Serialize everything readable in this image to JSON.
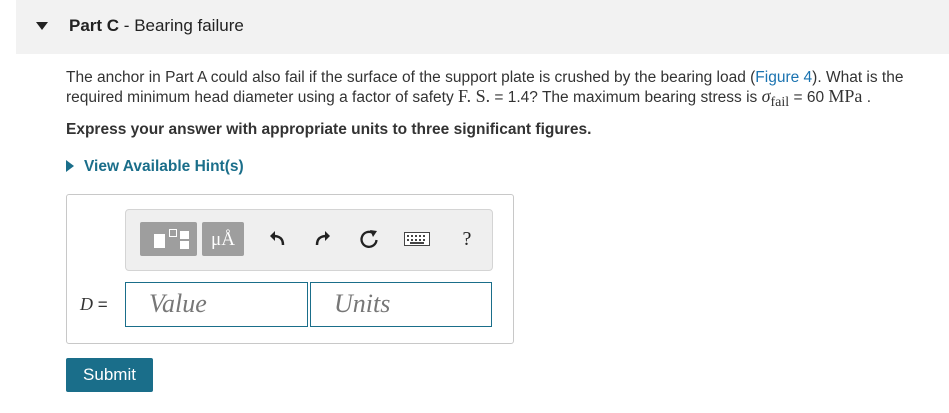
{
  "part": {
    "label": "Part C",
    "separator": " - ",
    "title": "Bearing failure"
  },
  "question": {
    "text1": "The anchor in Part A could also fail if the surface of the support plate is crushed by the bearing load (",
    "figure_link": "Figure 4",
    "text2": "). What is the required minimum head diameter using a factor of safety ",
    "fs_symbol": "F. S.",
    "text3": " = 1.4? The maximum bearing stress is ",
    "sigma": "σ",
    "sigma_sub": "fail",
    "text4": " = 60 ",
    "unit": "MPa",
    "text5": " ."
  },
  "instruction": "Express your answer with appropriate units to three significant figures.",
  "hint_label": "View Available Hint(s)",
  "toolbar": {
    "units_label": "μÅ",
    "help_label": "?"
  },
  "answer": {
    "var_label": "D",
    "equals": " =",
    "value_placeholder": "Value",
    "units_placeholder": "Units"
  },
  "submit_label": "Submit",
  "colors": {
    "link": "#1a73b0",
    "accent": "#1a6e8a",
    "header_bg": "#f2f2f2",
    "toolbar_btn": "#9e9e9e"
  }
}
